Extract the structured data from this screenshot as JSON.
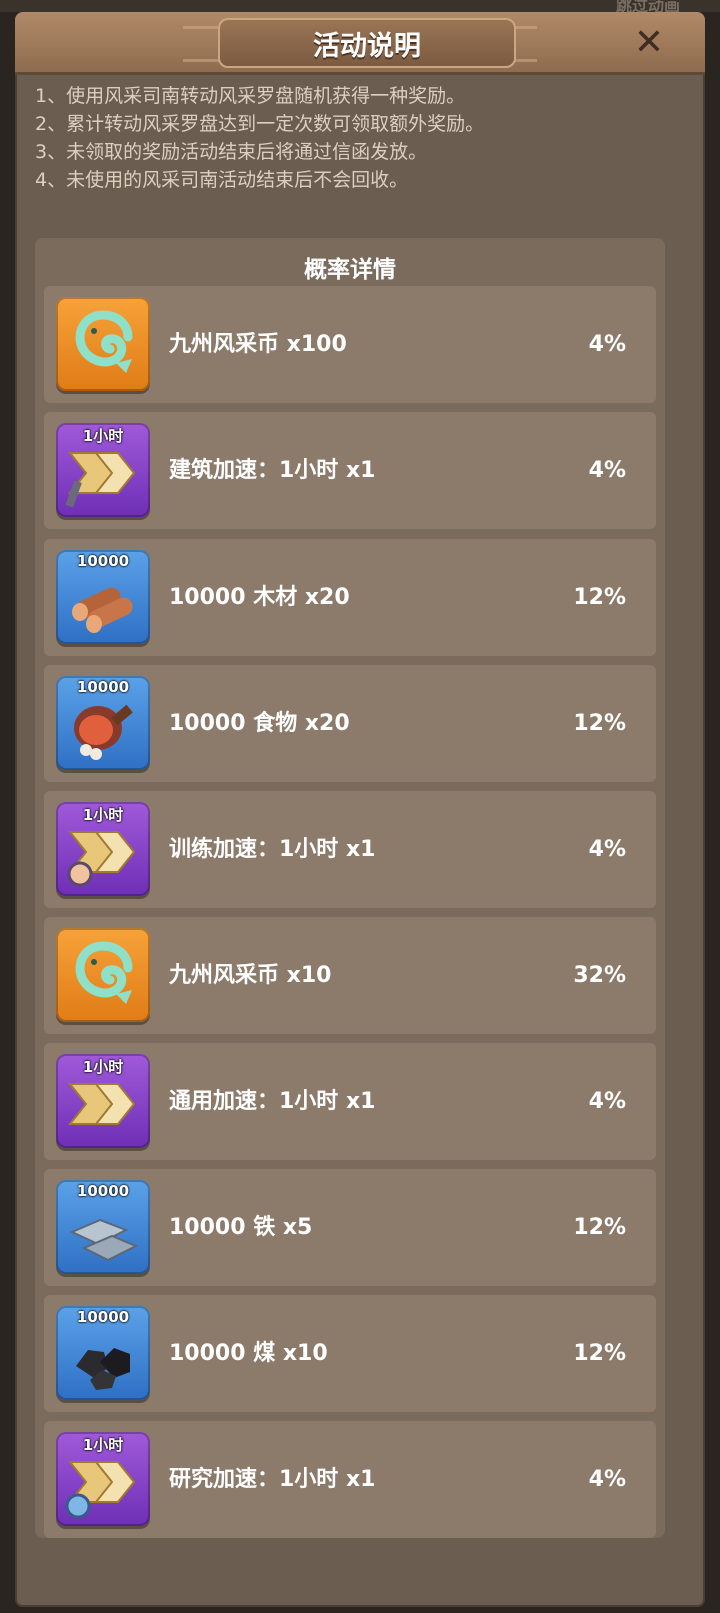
{
  "background": {
    "top_text": "跳过动画"
  },
  "header": {
    "title": "活动说明",
    "close_label": "✕"
  },
  "rules": [
    "1、使用风采司南转动风采罗盘随机获得一种奖励。",
    "2、累计转动风采罗盘达到一定次数可领取额外奖励。",
    "3、未领取的奖励活动结束后将通过信函发放。",
    "4、未使用的风采司南活动结束后不会回收。"
  ],
  "probability": {
    "title": "概率详情",
    "rows": [
      {
        "icon": "dragon-coin-icon",
        "icon_bg": "orange",
        "tag": "",
        "label": "九州风采币  x100",
        "pct": "4%"
      },
      {
        "icon": "build-speedup-icon",
        "icon_bg": "purple",
        "tag": "1小时",
        "label": "建筑加速：1小时  x1",
        "pct": "4%"
      },
      {
        "icon": "wood-icon",
        "icon_bg": "blue",
        "tag": "10000",
        "label": "10000 木材  x20",
        "pct": "12%"
      },
      {
        "icon": "food-icon",
        "icon_bg": "blue",
        "tag": "10000",
        "label": "10000 食物  x20",
        "pct": "12%"
      },
      {
        "icon": "train-speedup-icon",
        "icon_bg": "purple",
        "tag": "1小时",
        "label": "训练加速：1小时  x1",
        "pct": "4%"
      },
      {
        "icon": "dragon-coin-icon",
        "icon_bg": "orange",
        "tag": "",
        "label": "九州风采币  x10",
        "pct": "32%"
      },
      {
        "icon": "general-speedup-icon",
        "icon_bg": "purple",
        "tag": "1小时",
        "label": "通用加速：1小时  x1",
        "pct": "4%"
      },
      {
        "icon": "iron-icon",
        "icon_bg": "blue",
        "tag": "10000",
        "label": "10000 铁  x5",
        "pct": "12%"
      },
      {
        "icon": "coal-icon",
        "icon_bg": "blue",
        "tag": "10000",
        "label": "10000 煤  x10",
        "pct": "12%"
      },
      {
        "icon": "research-speedup-icon",
        "icon_bg": "purple",
        "tag": "1小时",
        "label": "研究加速：1小时  x1",
        "pct": "4%"
      }
    ]
  },
  "colors": {
    "panel": "#6b5d50",
    "header": "#a07c5d",
    "row": "#8c7a6b",
    "icon_orange": "#f08f28",
    "icon_purple": "#8a45c8",
    "icon_blue": "#4688d6"
  }
}
